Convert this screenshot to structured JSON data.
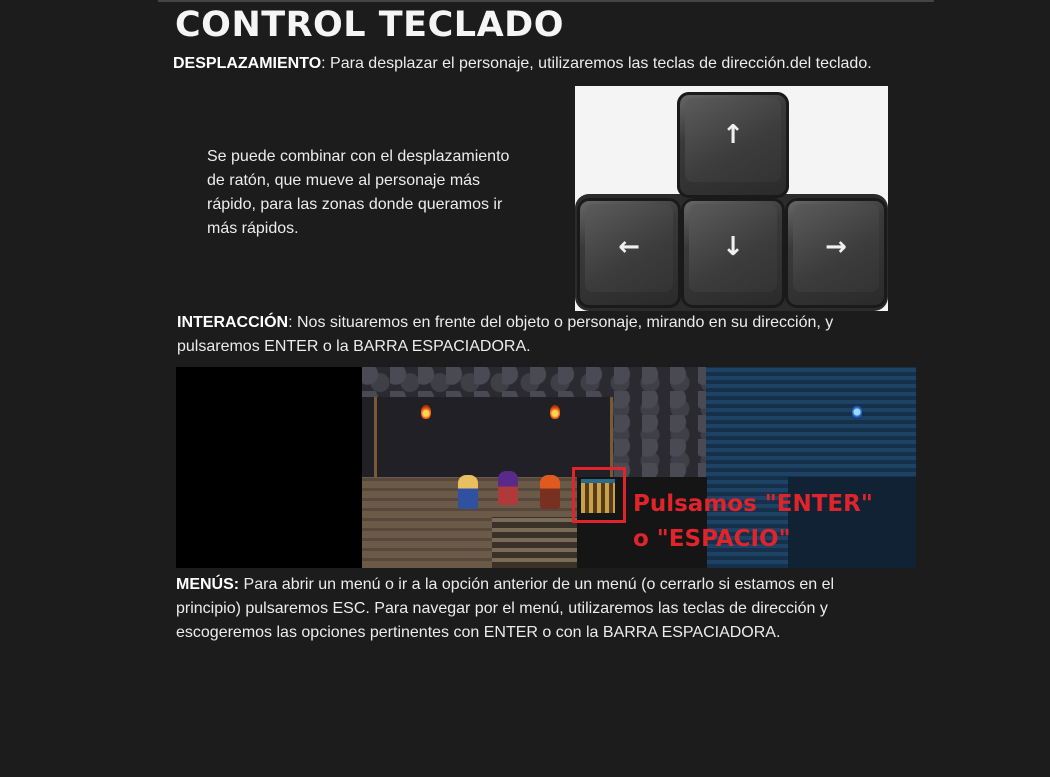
{
  "title": "CONTROL TECLADO",
  "desplazamiento": {
    "label": "DESPLAZAMIENTO",
    "text": ": Para desplazar el personaje, utilizaremos las teclas de dirección.del teclado."
  },
  "combine_text": "Se puede combinar con el desplazamiento de ratón, que mueve al personaje más rápido, para las zonas donde queramos ir más rápidos.",
  "arrow_keys": {
    "up": "↑",
    "left": "←",
    "down": "↓",
    "right": "→"
  },
  "interaccion": {
    "label": "INTERACCIÓN",
    "text": ": Nos situaremos en frente del objeto o personaje, mirando en su dirección, y pulsaremos ENTER o la BARRA ESPACIADORA."
  },
  "game_caption": {
    "line1": "Pulsamos \"ENTER\"",
    "line2": "o \"ESPACIO\""
  },
  "menus": {
    "label": "MENÚS:",
    "text": " Para abrir un menú o ir a la opción anterior de un menú (o cerrarlo si estamos en el principio) pulsaremos ESC. Para navegar por el menú, utilizaremos las teclas de dirección y escogeremos las opciones pertinentes con ENTER o con la BARRA ESPACIADORA."
  },
  "colors": {
    "background": "#1c1c1c",
    "text": "#ececec",
    "highlight": "#e0242c"
  }
}
